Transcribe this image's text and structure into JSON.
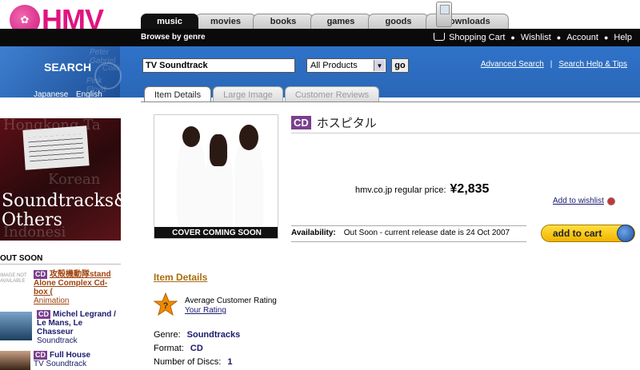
{
  "brand": {
    "name": "HMV"
  },
  "nav_tabs": [
    {
      "label": "music"
    },
    {
      "label": "movies"
    },
    {
      "label": "books"
    },
    {
      "label": "games"
    },
    {
      "label": "goods"
    },
    {
      "label": "downloads"
    }
  ],
  "topbar": {
    "browse": "Browse by genre",
    "links": [
      "Shopping Cart",
      "Wishlist",
      "Account",
      "Help"
    ]
  },
  "search": {
    "title": "SEARCH",
    "query": "TV Soundtrack",
    "category": "All Products",
    "go_label": "go",
    "languages": [
      "Japanese",
      "English"
    ],
    "advanced": "Advanced Search",
    "help": "Search Help & Tips",
    "panel_faint_text": [
      "Peter Gabriel",
      "Collins",
      "Pink Floyd"
    ]
  },
  "item_tabs": [
    "Item Details",
    "Large Image",
    "Customer Reviews"
  ],
  "sidebar": {
    "banner_text": "Soundtracks& Others",
    "banner_ghost": [
      "Hongkong Ta",
      "Korean",
      "Indonesi"
    ],
    "out_soon": "OUT SOON",
    "no_image": "IMAGE NOT AVAILABLE",
    "items": [
      {
        "format": "CD",
        "title": "攻殻機動隊stand Alone Complex Cd-box (",
        "subtitle": "Animation"
      },
      {
        "format": "CD",
        "title": "Michel Legrand / Le Mans, Le Chasseur",
        "subtitle": "Soundtrack"
      },
      {
        "format": "CD",
        "title": "Full House",
        "subtitle": "TV Soundtrack"
      }
    ]
  },
  "product": {
    "format": "CD",
    "title": "ホスピタル",
    "cover_caption": "COVER COMING SOON",
    "price_label": "hmv.co.jp regular price:",
    "price": "¥2,835",
    "wishlist": "Add to wishlist",
    "availability_label": "Availability:",
    "availability": "Out Soon - current release date is 24 Oct 2007",
    "add_to_cart": "add to cart"
  },
  "details": {
    "section_title": "Item Details",
    "rating_label": "Average Customer Rating",
    "your_rating": "Your Rating",
    "rows": [
      {
        "label": "Genre:",
        "value": "Soundtracks"
      },
      {
        "label": "Format:",
        "value": "CD"
      },
      {
        "label": "Number of Discs:",
        "value": "1"
      }
    ]
  },
  "colors": {
    "brand_pink": "#e0147f",
    "search_blue": "#2f73c9",
    "cd_badge": "#7a3f8e",
    "cart_yellow": "#f1b400"
  }
}
